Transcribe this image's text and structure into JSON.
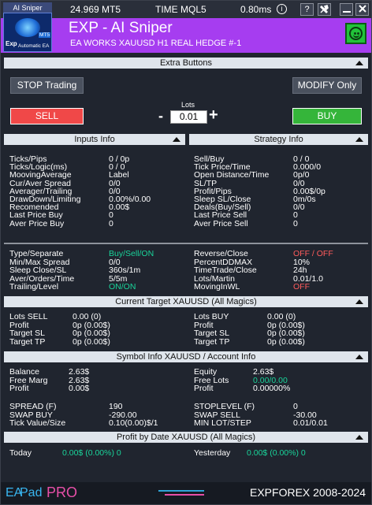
{
  "header": {
    "logo_tag": "AI Sniper",
    "logo_exp": "Exp",
    "logo_mt5": "MT5",
    "logo_sub": "Automatic EA",
    "price": "24.969 MT5",
    "time_label": "TIME MQL5",
    "latency": "0.80ms",
    "info_icon": "info-circle-icon",
    "help_label": "?",
    "title": "EXP - AI Sniper",
    "subtitle": "EA WORKS XAUUSD H1 REAL HEDGE  #-1",
    "status_icon": "smiley-icon",
    "accent": "#a63df0"
  },
  "extra": {
    "title": "Extra Buttons",
    "stop_label": "STOP Trading",
    "modify_label": "MODIFY Only",
    "sell_label": "SELL",
    "buy_label": "BUY",
    "lots_label": "Lots",
    "lots_value": "0.01",
    "minus": "-",
    "plus": "+",
    "sell_color": "#f04848",
    "buy_color": "#35b53a"
  },
  "inputs_info": {
    "title": "Inputs Info",
    "rows": [
      {
        "label": "Ticks/Pips",
        "value": "0 / 0p"
      },
      {
        "label": "Ticks/Logic(ms)",
        "value": "0 / 0"
      },
      {
        "label": "MoovingAverage",
        "value": "Label"
      },
      {
        "label": "Cur/Aver Spread",
        "value": "0/0"
      },
      {
        "label": "Averager/Trailing",
        "value": "0/0"
      },
      {
        "label": "DrawDown/Limiting",
        "value": "0.00%/0.00"
      },
      {
        "label": "Recomended",
        "value": "0.00$"
      },
      {
        "label": "Last Price Buy",
        "value": "0"
      },
      {
        "label": "Aver Price Buy",
        "value": "0"
      }
    ]
  },
  "strategy_info": {
    "title": "Strategy Info",
    "rows": [
      {
        "label": "Sell/Buy",
        "value": "0 / 0"
      },
      {
        "label": "Tick Price/Time",
        "value": "0.000/0"
      },
      {
        "label": "Open Distance/Time",
        "value": "0p/0"
      },
      {
        "label": "SL/TP",
        "value": "0/0"
      },
      {
        "label": "Profit/Pips",
        "value": "0.00$/0p"
      },
      {
        "label": "Sleep SL/Close",
        "value": "0m/0s"
      },
      {
        "label": "Deals(Buy/Sell)",
        "value": "0/0"
      },
      {
        "label": "Last Price Sell",
        "value": "0"
      },
      {
        "label": "Aver Price Sell",
        "value": "0"
      }
    ]
  },
  "settings": {
    "left": [
      {
        "label": "Type/Separate",
        "value": "Buy/Sell/ON",
        "color": "green"
      },
      {
        "label": "Min/Max Spread",
        "value": "0/0",
        "color": "white"
      },
      {
        "label": "Sleep Close/SL",
        "value": "360s/1m",
        "color": "white"
      },
      {
        "label": "Aver/Orders/Time",
        "value": "5/5m",
        "color": "white"
      },
      {
        "label": "Trailing/Level",
        "value": "ON/ON",
        "color": "green"
      }
    ],
    "right": [
      {
        "label": "Reverse/Close",
        "value": "OFF / OFF",
        "color": "red"
      },
      {
        "label": "PercentDDMAX",
        "value": "10%",
        "color": "white"
      },
      {
        "label": "TimeTrade/Close",
        "value": "24h",
        "color": "white"
      },
      {
        "label": "Lots/Martin",
        "value": "0.01/1.0",
        "color": "white"
      },
      {
        "label": "MovingInWL",
        "value": "OFF",
        "color": "red"
      }
    ]
  },
  "current_target": {
    "title": "Current Target XAUUSD (All Magics)",
    "left": [
      {
        "label": "Lots SELL",
        "value": "0.00 (0)"
      },
      {
        "label": "Profit",
        "value": "0p (0.00$)"
      },
      {
        "label": "Target SL",
        "value": "0p (0.00$)"
      },
      {
        "label": "Target TP",
        "value": "0p (0.00$)"
      }
    ],
    "right": [
      {
        "label": "Lots BUY",
        "value": "0.00 (0)"
      },
      {
        "label": "Profit",
        "value": "0p (0.00$)"
      },
      {
        "label": "Target SL",
        "value": "0p (0.00$)"
      },
      {
        "label": "Target TP",
        "value": "0p (0.00$)"
      }
    ]
  },
  "symbol_info": {
    "title": "Symbol Info XAUUSD / Account Info",
    "left": [
      {
        "label": "Balance",
        "value": "2.63$",
        "color": "white"
      },
      {
        "label": "Free Marg",
        "value": "2.63$",
        "color": "white"
      },
      {
        "label": "Profit",
        "value": "0.00$",
        "color": "white"
      }
    ],
    "right": [
      {
        "label": "Equity",
        "value": "2.63$",
        "color": "white"
      },
      {
        "label": "Free Lots",
        "value": "0.00/0.00",
        "color": "green"
      },
      {
        "label": "Profit",
        "value": "0.00000%",
        "color": "white"
      }
    ],
    "left2": [
      {
        "label": "SPREAD (F)",
        "value": "190"
      },
      {
        "label": "SWAP BUY",
        "value": "-290.00"
      },
      {
        "label": "Tick Value/Size",
        "value": "0.10(0.00)$/1"
      }
    ],
    "right2": [
      {
        "label": "STOPLEVEL (F)",
        "value": "0"
      },
      {
        "label": "SWAP SELL",
        "value": "-30.00"
      },
      {
        "label": "MIN LOT/STEP",
        "value": "0.01/0.01"
      }
    ]
  },
  "profit_by_date": {
    "title": "Profit by Date XAUUSD (All Magics)",
    "today_label": "Today",
    "today_value": "0.00$ (0.00%) 0",
    "yesterday_label": "Yesterday",
    "yesterday_value": "0.00$ (0.00%) 0"
  },
  "footer": {
    "ea": "EA",
    "pad": "Pad",
    "pro": "PRO",
    "copyright": "EXPFOREX 2008-2024"
  }
}
